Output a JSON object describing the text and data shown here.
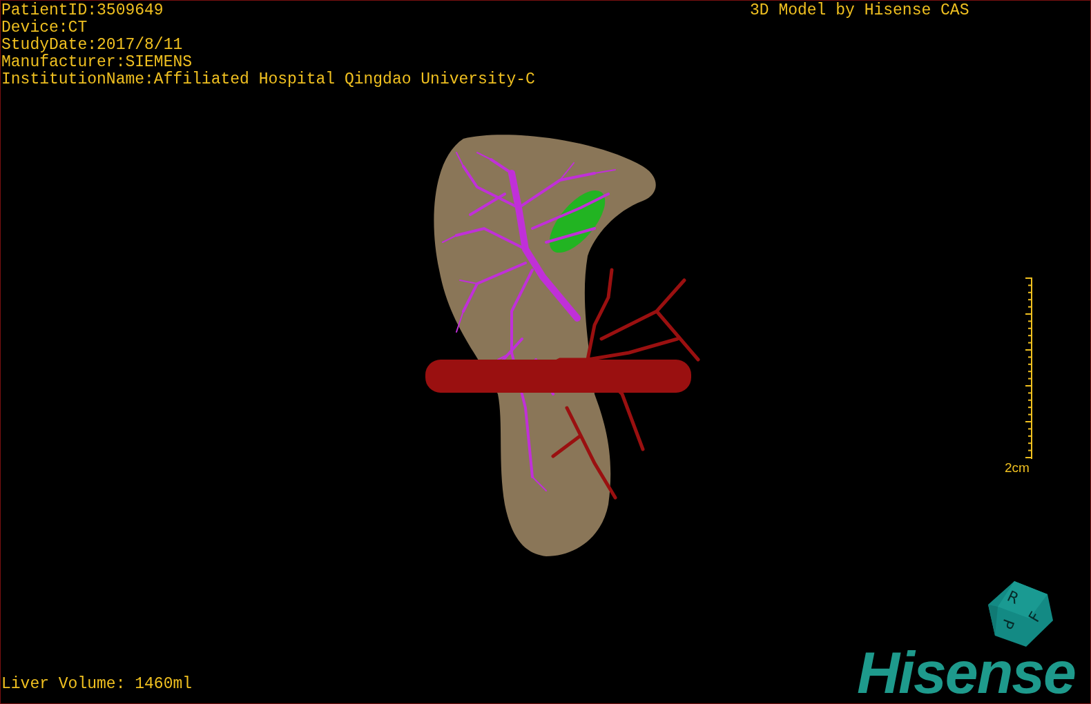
{
  "viewport": {
    "patient_info": [
      "PatientID:3509649",
      "Device:CT",
      "StudyDate:2017/8/11",
      "Manufacturer:SIEMENS",
      "InstitutionName:Affiliated Hospital Qingdao University-C"
    ],
    "title": "3D Model by Hisense CAS",
    "scale_bar": {
      "label": "2cm"
    },
    "orientation_cube": {
      "labels": [
        "R",
        "F",
        "P"
      ]
    },
    "logo": "Hisense",
    "liver_volume": "Liver Volume: 1460ml"
  }
}
